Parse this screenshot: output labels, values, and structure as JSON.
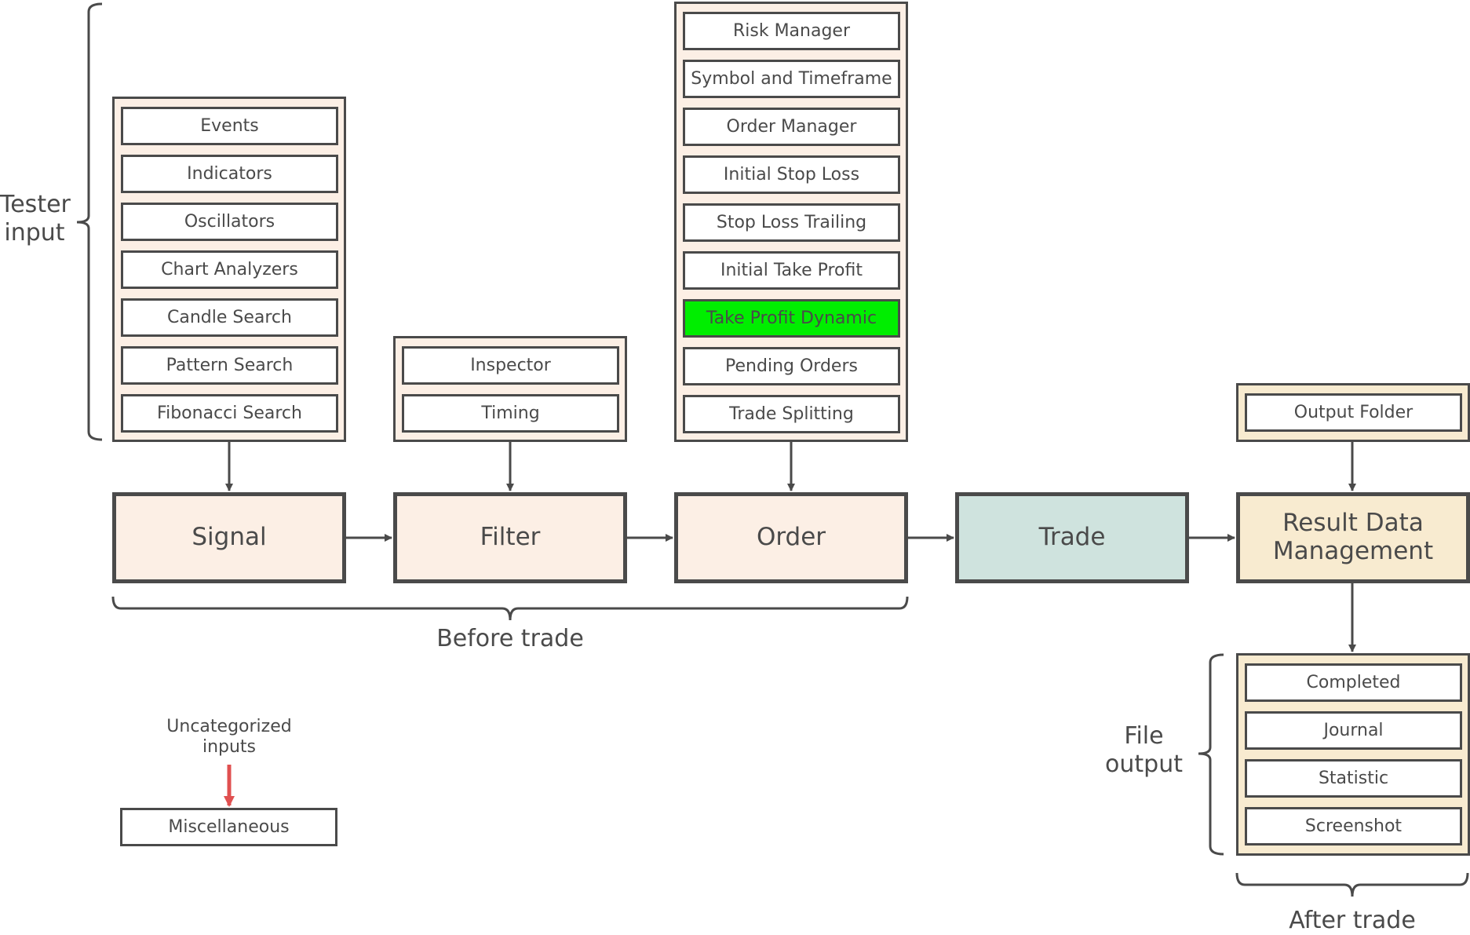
{
  "labels": {
    "tester_input": "Tester\ninput",
    "file_output": "File\noutput",
    "before_trade": "Before trade",
    "after_trade": "After trade",
    "uncategorized": "Uncategorized\ninputs"
  },
  "stages": {
    "signal": "Signal",
    "filter": "Filter",
    "order": "Order",
    "trade": "Trade",
    "result": "Result Data\nManagement"
  },
  "signal_inputs": [
    "Events",
    "Indicators",
    "Oscillators",
    "Chart Analyzers",
    "Candle Search",
    "Pattern Search",
    "Fibonacci Search"
  ],
  "filter_inputs": [
    "Inspector",
    "Timing"
  ],
  "order_inputs": [
    "Risk Manager",
    "Symbol and Timeframe",
    "Order Manager",
    "Initial Stop Loss",
    "Stop Loss Trailing",
    "Initial Take Profit",
    "Take Profit Dynamic",
    "Pending Orders",
    "Trade Splitting"
  ],
  "order_highlighted_index": 6,
  "result_inputs": [
    "Output Folder"
  ],
  "file_outputs": [
    "Completed",
    "Journal",
    "Statistic",
    "Screenshot"
  ],
  "misc": "Miscellaneous",
  "colors": {
    "stroke": "#4a4a4a",
    "peach": "#fcefe5",
    "teal": "#cfe3de",
    "cream": "#f8ebd0",
    "highlight": "#00ee00",
    "red_arrow": "#e05050"
  }
}
